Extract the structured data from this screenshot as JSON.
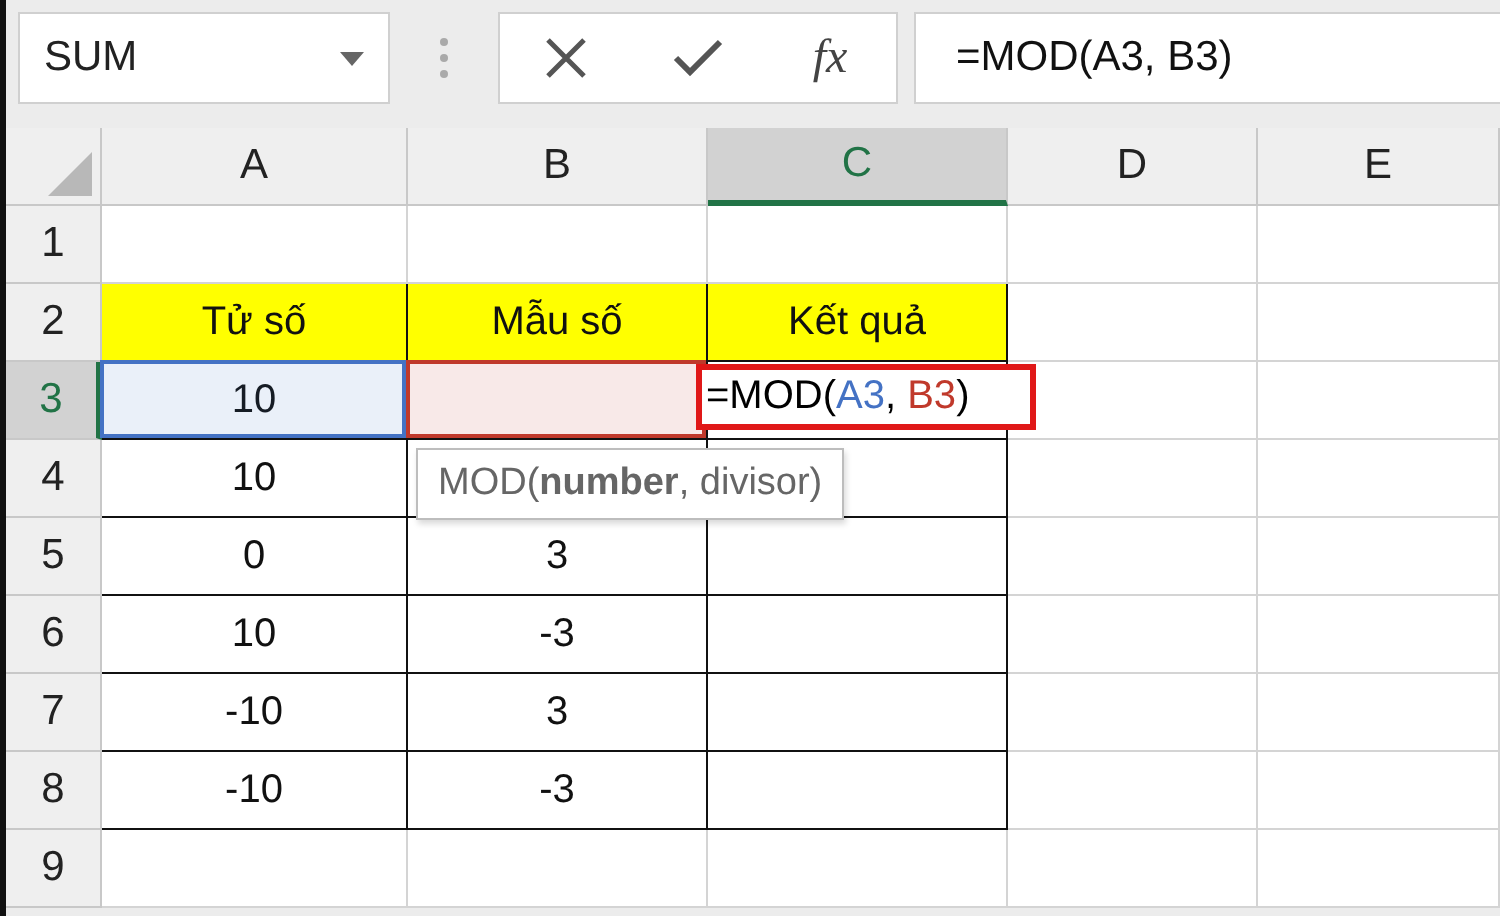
{
  "name_box": {
    "value": "SUM"
  },
  "formula_bar": {
    "function_label": "fx",
    "value": "=MOD(A3, B3)"
  },
  "columns": [
    {
      "label": "A",
      "selected": false
    },
    {
      "label": "B",
      "selected": false
    },
    {
      "label": "C",
      "selected": true
    },
    {
      "label": "D",
      "selected": false
    },
    {
      "label": "E",
      "selected": false
    }
  ],
  "rows": [
    {
      "label": "1",
      "selected": false,
      "cells": [
        {
          "kind": "blank"
        },
        {
          "kind": "blank"
        },
        {
          "kind": "blank"
        },
        {
          "kind": "blank"
        },
        {
          "kind": "blank"
        }
      ]
    },
    {
      "label": "2",
      "selected": false,
      "cells": [
        {
          "kind": "header",
          "text": "Tử số"
        },
        {
          "kind": "header",
          "text": "Mẫu số"
        },
        {
          "kind": "header",
          "text": "Kết quả"
        },
        {
          "kind": "blank"
        },
        {
          "kind": "blank"
        }
      ]
    },
    {
      "label": "3",
      "selected": true,
      "cells": [
        {
          "kind": "data",
          "text": "10",
          "color": "#4472c4"
        },
        {
          "kind": "data",
          "color": "#c0392b"
        },
        {
          "kind": "editing",
          "tokens": [
            {
              "text": "=MOD(",
              "color": "#000000"
            },
            {
              "text": "A3",
              "color": "#4472c4"
            },
            {
              "text": ", ",
              "color": "#000000"
            },
            {
              "text": "B3",
              "color": "#c0392b"
            },
            {
              "text": ")",
              "color": "#000000"
            }
          ]
        },
        {
          "kind": "blank"
        },
        {
          "kind": "blank"
        }
      ]
    },
    {
      "label": "4",
      "selected": false,
      "cells": [
        {
          "kind": "data",
          "text": "10"
        },
        {
          "kind": "data"
        },
        {
          "kind": "data"
        },
        {
          "kind": "blank"
        },
        {
          "kind": "blank"
        }
      ]
    },
    {
      "label": "5",
      "selected": false,
      "cells": [
        {
          "kind": "data",
          "text": "0"
        },
        {
          "kind": "data",
          "text": "3"
        },
        {
          "kind": "data"
        },
        {
          "kind": "blank"
        },
        {
          "kind": "blank"
        }
      ]
    },
    {
      "label": "6",
      "selected": false,
      "cells": [
        {
          "kind": "data",
          "text": "10"
        },
        {
          "kind": "data",
          "text": "-3"
        },
        {
          "kind": "data"
        },
        {
          "kind": "blank"
        },
        {
          "kind": "blank"
        }
      ]
    },
    {
      "label": "7",
      "selected": false,
      "cells": [
        {
          "kind": "data",
          "text": "-10"
        },
        {
          "kind": "data",
          "text": "3"
        },
        {
          "kind": "data"
        },
        {
          "kind": "blank"
        },
        {
          "kind": "blank"
        }
      ]
    },
    {
      "label": "8",
      "selected": false,
      "cells": [
        {
          "kind": "data",
          "text": "-10"
        },
        {
          "kind": "data",
          "text": "-3"
        },
        {
          "kind": "data"
        },
        {
          "kind": "blank"
        },
        {
          "kind": "blank"
        }
      ]
    },
    {
      "label": "9",
      "selected": false,
      "cells": [
        {
          "kind": "blank"
        },
        {
          "kind": "blank"
        },
        {
          "kind": "blank"
        },
        {
          "kind": "blank"
        },
        {
          "kind": "blank"
        }
      ]
    }
  ],
  "tooltip": {
    "text": "MOD(**number**, divisor)"
  }
}
